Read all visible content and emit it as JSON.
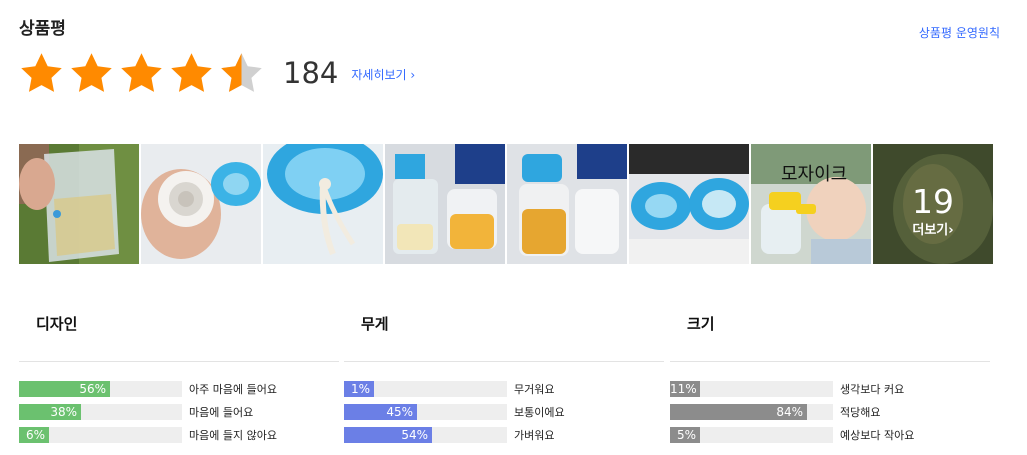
{
  "header": {
    "title": "상품평",
    "policy_link": "상품평 운영원칙"
  },
  "rating": {
    "value": 4.5,
    "max": 5,
    "count": "184",
    "detail_link": "자세히보기",
    "star_color": "#ff8a00",
    "star_empty_color": "#d0d0d0"
  },
  "photos": {
    "items": [
      {
        "name": "review-photo-1"
      },
      {
        "name": "review-photo-2"
      },
      {
        "name": "review-photo-3"
      },
      {
        "name": "review-photo-4"
      },
      {
        "name": "review-photo-5"
      },
      {
        "name": "review-photo-6"
      },
      {
        "name": "review-photo-7"
      }
    ],
    "more_count": "19",
    "more_label": "더보기"
  },
  "surveys": [
    {
      "title": "디자인",
      "color": "#6bc16f",
      "rows": [
        {
          "percent": 56,
          "percent_label": "56%",
          "label": "아주 마음에 들어요"
        },
        {
          "percent": 38,
          "percent_label": "38%",
          "label": "마음에 들어요"
        },
        {
          "percent": 6,
          "percent_label": "6%",
          "label": "마음에 들지 않아요"
        }
      ]
    },
    {
      "title": "무게",
      "color": "#6b7fe6",
      "rows": [
        {
          "percent": 1,
          "percent_label": "1%",
          "label": "무거워요"
        },
        {
          "percent": 45,
          "percent_label": "45%",
          "label": "보통이에요"
        },
        {
          "percent": 54,
          "percent_label": "54%",
          "label": "가벼워요"
        }
      ]
    },
    {
      "title": "크기",
      "color": "#8c8c8c",
      "rows": [
        {
          "percent": 11,
          "percent_label": "11%",
          "label": "생각보다 커요"
        },
        {
          "percent": 84,
          "percent_label": "84%",
          "label": "적당해요"
        },
        {
          "percent": 5,
          "percent_label": "5%",
          "label": "예상보다 작아요"
        }
      ]
    }
  ]
}
